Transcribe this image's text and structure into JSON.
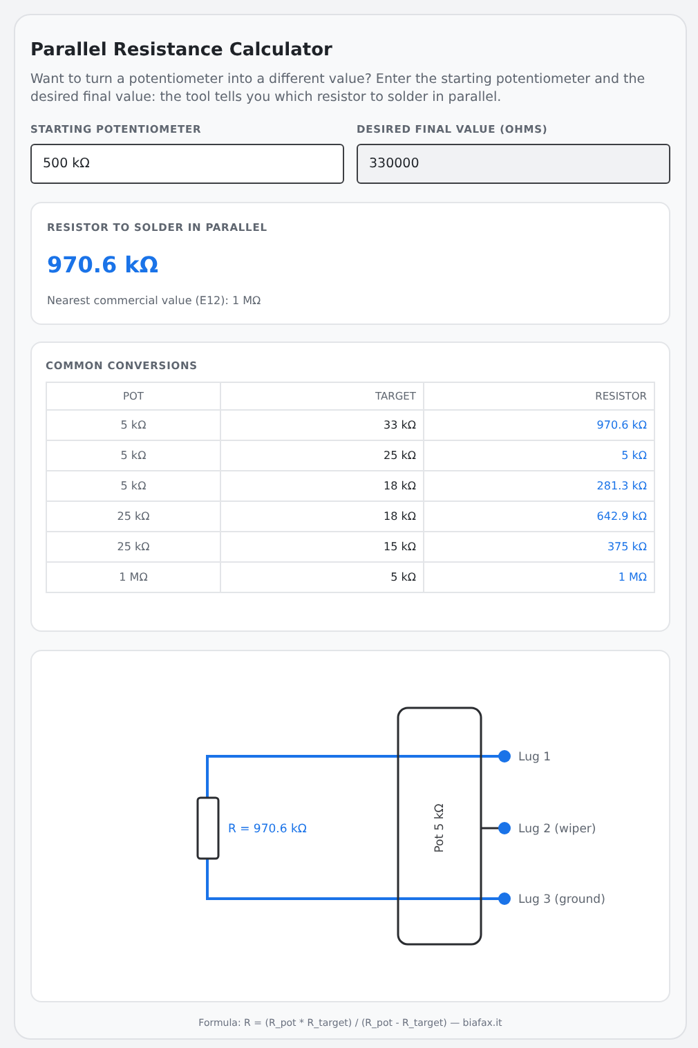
{
  "title": "Parallel Resistance Calculator",
  "description": "Want to turn a potentiometer into a different value? Enter the starting potentiometer and the desired final value: the tool tells you which resistor to solder in parallel.",
  "fields": [
    {
      "label": "STARTING POTENTIOMETER",
      "value": "500 kΩ",
      "disabled": false
    },
    {
      "label": "DESIRED FINAL VALUE (OHMS)",
      "value": "330000",
      "disabled": true
    }
  ],
  "result": {
    "label": "RESISTOR TO SOLDER IN PARALLEL",
    "value": "970.6 kΩ",
    "note": "Nearest commercial value (E12): 1 MΩ"
  },
  "table": {
    "title": "COMMON CONVERSIONS",
    "columns": [
      "POT",
      "TARGET",
      "RESISTOR"
    ],
    "rows": [
      [
        "5 kΩ",
        "33 kΩ",
        "970.6 kΩ"
      ],
      [
        "5 kΩ",
        "25 kΩ",
        "5 kΩ"
      ],
      [
        "5 kΩ",
        "18 kΩ",
        "281.3 kΩ"
      ],
      [
        "25 kΩ",
        "18 kΩ",
        "642.9 kΩ"
      ],
      [
        "25 kΩ",
        "15 kΩ",
        "375 kΩ"
      ],
      [
        "1 MΩ",
        "5 kΩ",
        "1 MΩ"
      ]
    ]
  },
  "diagram": {
    "resistor_label": "R = 970.6 kΩ",
    "pot_label": "Pot 5 kΩ",
    "lugs": [
      "Lug 1",
      "Lug 2 (wiper)",
      "Lug 3 (ground)"
    ]
  },
  "footer": "Formula: R = (R_pot * R_target) / (R_pot - R_target) — biafax.it"
}
